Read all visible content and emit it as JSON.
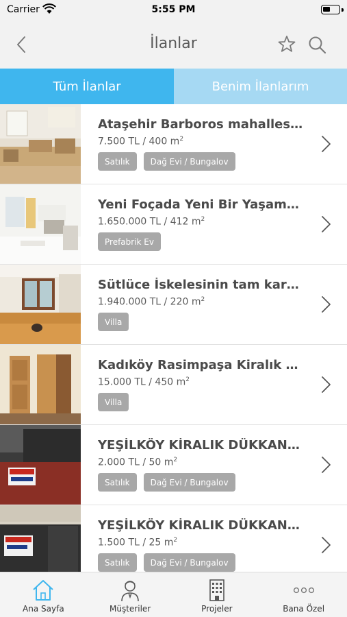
{
  "status_bar": {
    "carrier": "Carrier",
    "time": "5:55 PM"
  },
  "nav": {
    "title": "İlanlar"
  },
  "tabs": [
    {
      "label": "Tüm İlanlar",
      "active": true
    },
    {
      "label": "Benim İlanlarım",
      "active": false
    }
  ],
  "listings": [
    {
      "title": "Ataşehir Barboros mahallesi...",
      "price": "7.500 TL / 400 m",
      "unit_sup": "2",
      "tags": [
        "Satılık",
        "Dağ Evi / Bungalov"
      ]
    },
    {
      "title": "Yeni Foçada Yeni Bir Yaşam;...",
      "price": "1.650.000 TL / 412 m",
      "unit_sup": "2",
      "tags": [
        "Prefabrik Ev"
      ]
    },
    {
      "title": "Sütlüce İskelesinin tam karşı...",
      "price": "1.940.000 TL / 220 m",
      "unit_sup": "2",
      "tags": [
        "Villa"
      ]
    },
    {
      "title": "Kadıköy Rasimpaşa Kiralık  K...",
      "price": "15.000 TL / 450 m",
      "unit_sup": "2",
      "tags": [
        "Villa"
      ]
    },
    {
      "title": "YEŞİLKÖY KİRALIK DÜKKAN İŞY...",
      "price": "2.000 TL / 50 m",
      "unit_sup": "2",
      "tags": [
        "Satılık",
        "Dağ Evi / Bungalov"
      ]
    },
    {
      "title": "YEŞİLKÖY KİRALIK DÜKKAN İŞY...",
      "price": "1.500 TL / 25 m",
      "unit_sup": "2",
      "tags": [
        "Satılık",
        "Dağ Evi / Bungalov"
      ]
    }
  ],
  "tab_bar": [
    {
      "label": "Ana Sayfa",
      "icon": "home-icon",
      "active": true
    },
    {
      "label": "Müşteriler",
      "icon": "customer-icon",
      "active": false
    },
    {
      "label": "Projeler",
      "icon": "building-icon",
      "active": false
    },
    {
      "label": "Bana Özel",
      "icon": "more-icon",
      "active": false
    }
  ],
  "colors": {
    "accent": "#3fb6ee",
    "accent_light": "#a6d9f3",
    "tag_bg": "#a8a8a8",
    "tab_icon_active": "#3fb6ee"
  }
}
